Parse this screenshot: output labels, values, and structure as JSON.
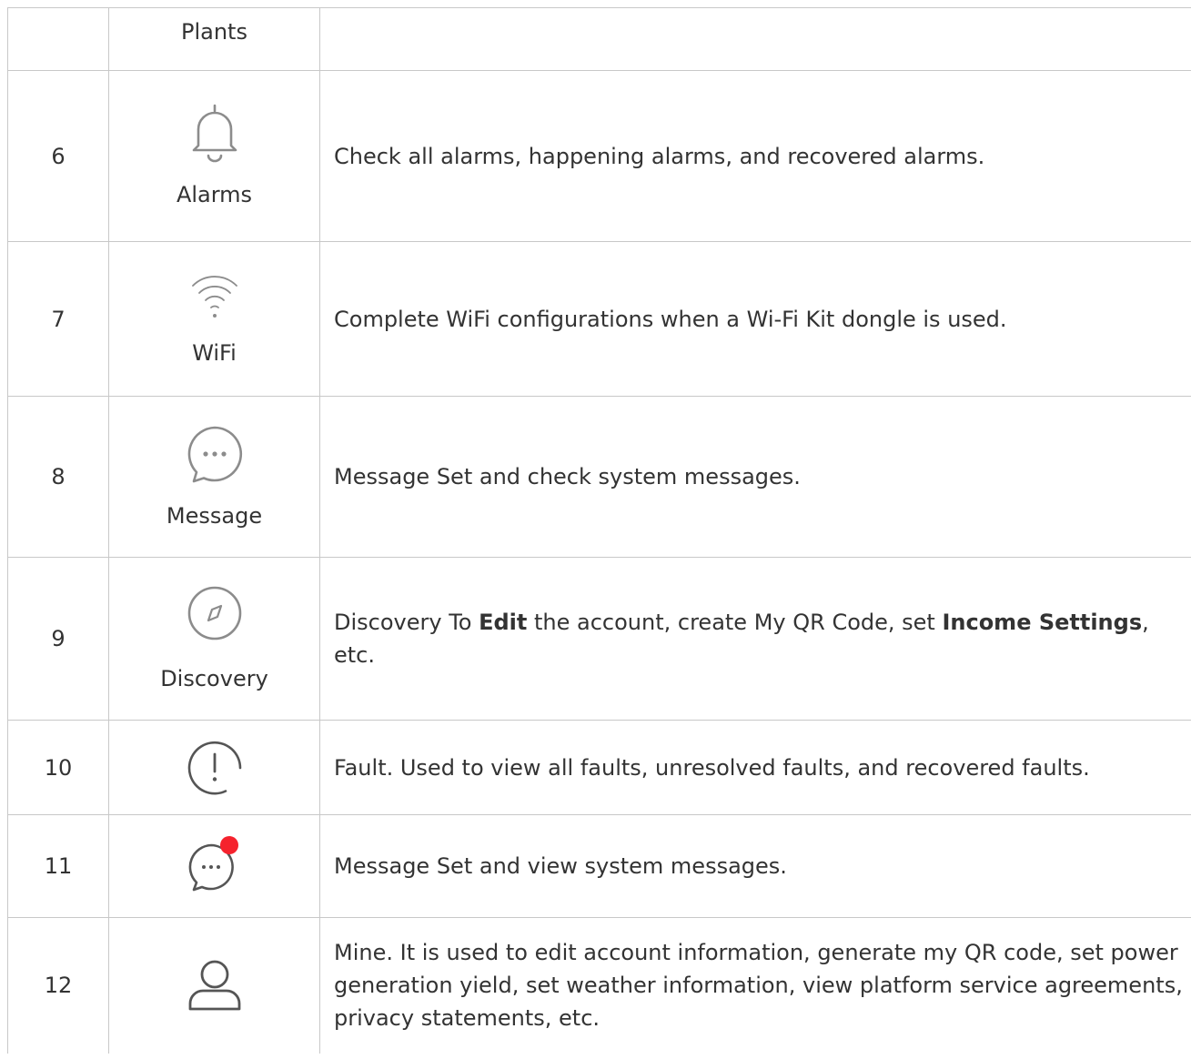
{
  "rows": [
    {
      "num": "",
      "icon": "",
      "label": "Plants",
      "desc": ""
    },
    {
      "num": "6",
      "icon": "bell-icon",
      "label": "Alarms",
      "desc": "Check all alarms, happening alarms, and recovered alarms."
    },
    {
      "num": "7",
      "icon": "wifi-icon",
      "label": "WiFi",
      "desc": "Complete WiFi configurations when a Wi-Fi Kit dongle is used."
    },
    {
      "num": "8",
      "icon": "chat-bubble-icon",
      "label": "Message",
      "desc": "Message Set and check system messages."
    },
    {
      "num": "9",
      "icon": "compass-icon",
      "label": "Discovery",
      "desc_parts": [
        "Discovery To ",
        "Edit",
        " the account,  create My QR Code,  set ",
        "Income Settings",
        ",  etc."
      ]
    },
    {
      "num": "10",
      "icon": "fault-icon",
      "label": "",
      "desc": "Fault. Used to view all faults, unresolved faults, and recovered faults."
    },
    {
      "num": "11",
      "icon": "chat-notification-icon",
      "label": "",
      "desc": "Message Set and view system messages."
    },
    {
      "num": "12",
      "icon": "user-icon",
      "label": "",
      "desc": "Mine. It is used to edit account information,  generate my QR code,  set power generation yield,  set weather information,  view platform service agreements,  privacy statements,  etc."
    }
  ],
  "colors": {
    "border": "#c8c8c8",
    "text": "#333333",
    "icon": "#8c8c8c",
    "notification_dot": "#f5222d"
  }
}
